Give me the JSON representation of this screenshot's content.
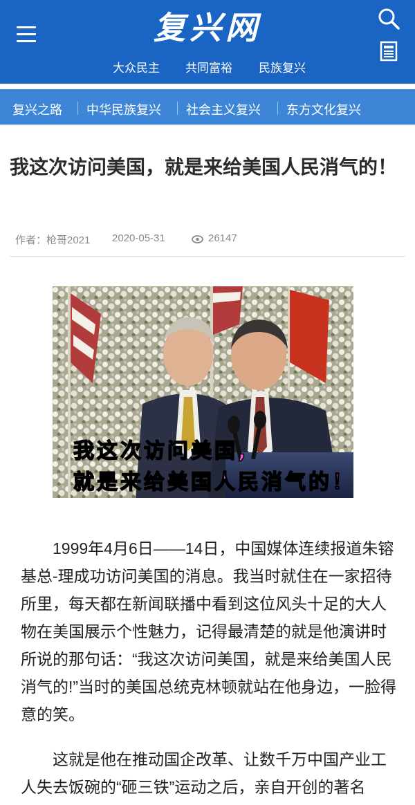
{
  "header": {
    "logo": "复兴网",
    "slogans": [
      "大众民主",
      "共同富裕",
      "民族复兴"
    ],
    "icons": {
      "menu": "menu-icon",
      "search": "search-icon",
      "news": "news-icon"
    }
  },
  "nav": {
    "items": [
      "复兴之路",
      "中华民族复兴",
      "社会主义复兴",
      "东方文化复兴"
    ]
  },
  "article": {
    "title": "我这次访问美国，就是来给美国人民消气的！",
    "author": "作者：枪哥2021",
    "date": "2020-05-31",
    "views": "26147",
    "image_caption_line1": "我这次访问美国,",
    "image_caption_line2": "就是来给美国人民消气的！",
    "paragraphs": [
      "1999年4月6日——14日，中国媒体连续报道朱镕基总-理成功访问美国的消息。我当时就住在一家招待所里，每天都在新闻联播中看到这位风头十足的大人物在美国展示个性魅力，记得最清楚的就是他演讲时所说的那句话：“我这次访问美国，就是来给美国人民消气的!”当时的美国总统克林顿就站在他身边，一脸得意的笑。",
      "这就是他在推动国企改革、让数千万中国产业工人失去饭碗的“砸三铁”运动之后，亲自开创的著名"
    ]
  },
  "colors": {
    "header_bg": "#1a64c4",
    "nav_bg": "#3d85d6",
    "caption": "#ff4fd8"
  }
}
